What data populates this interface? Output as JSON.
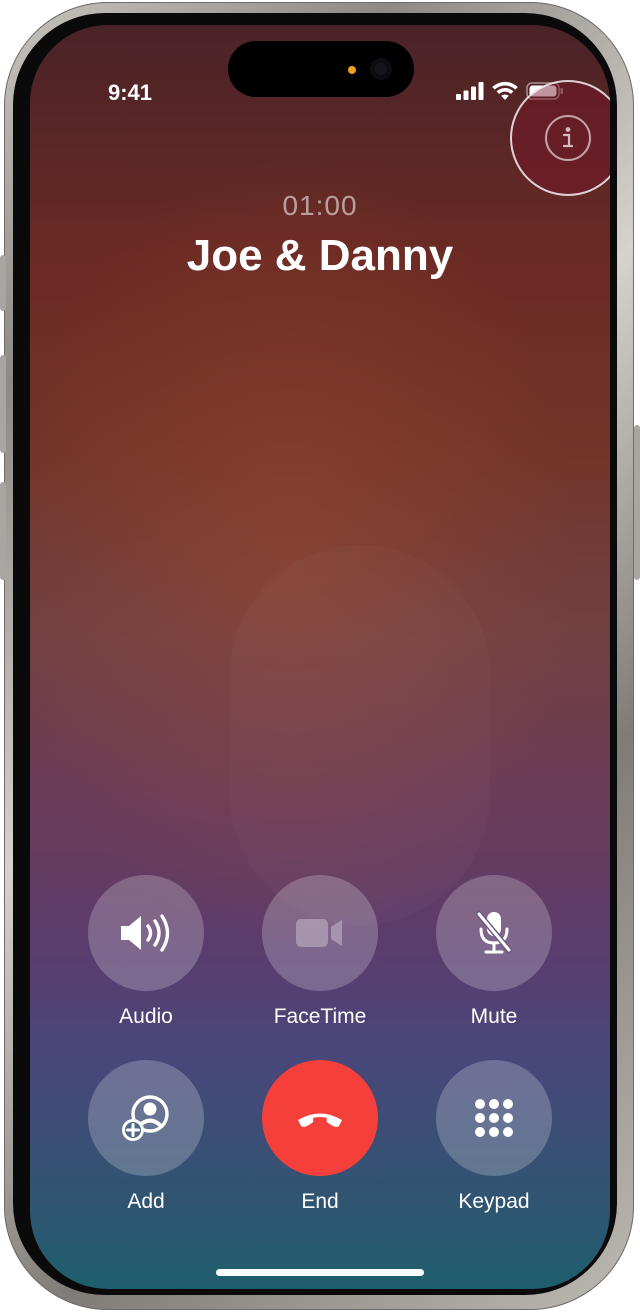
{
  "status_bar": {
    "time": "9:41",
    "icons": [
      "cellular-signal-icon",
      "wifi-icon",
      "battery-icon"
    ]
  },
  "call": {
    "duration": "01:00",
    "name": "Joe & Danny",
    "info_icon": "info-icon"
  },
  "controls": {
    "audio_label": "Audio",
    "facetime_label": "FaceTime",
    "mute_label": "Mute",
    "add_label": "Add",
    "end_label": "End",
    "keypad_label": "Keypad"
  },
  "colors": {
    "end_button": "#f53f3a",
    "button_fill": "rgba(255,255,255,0.22)",
    "text": "#ffffff"
  }
}
